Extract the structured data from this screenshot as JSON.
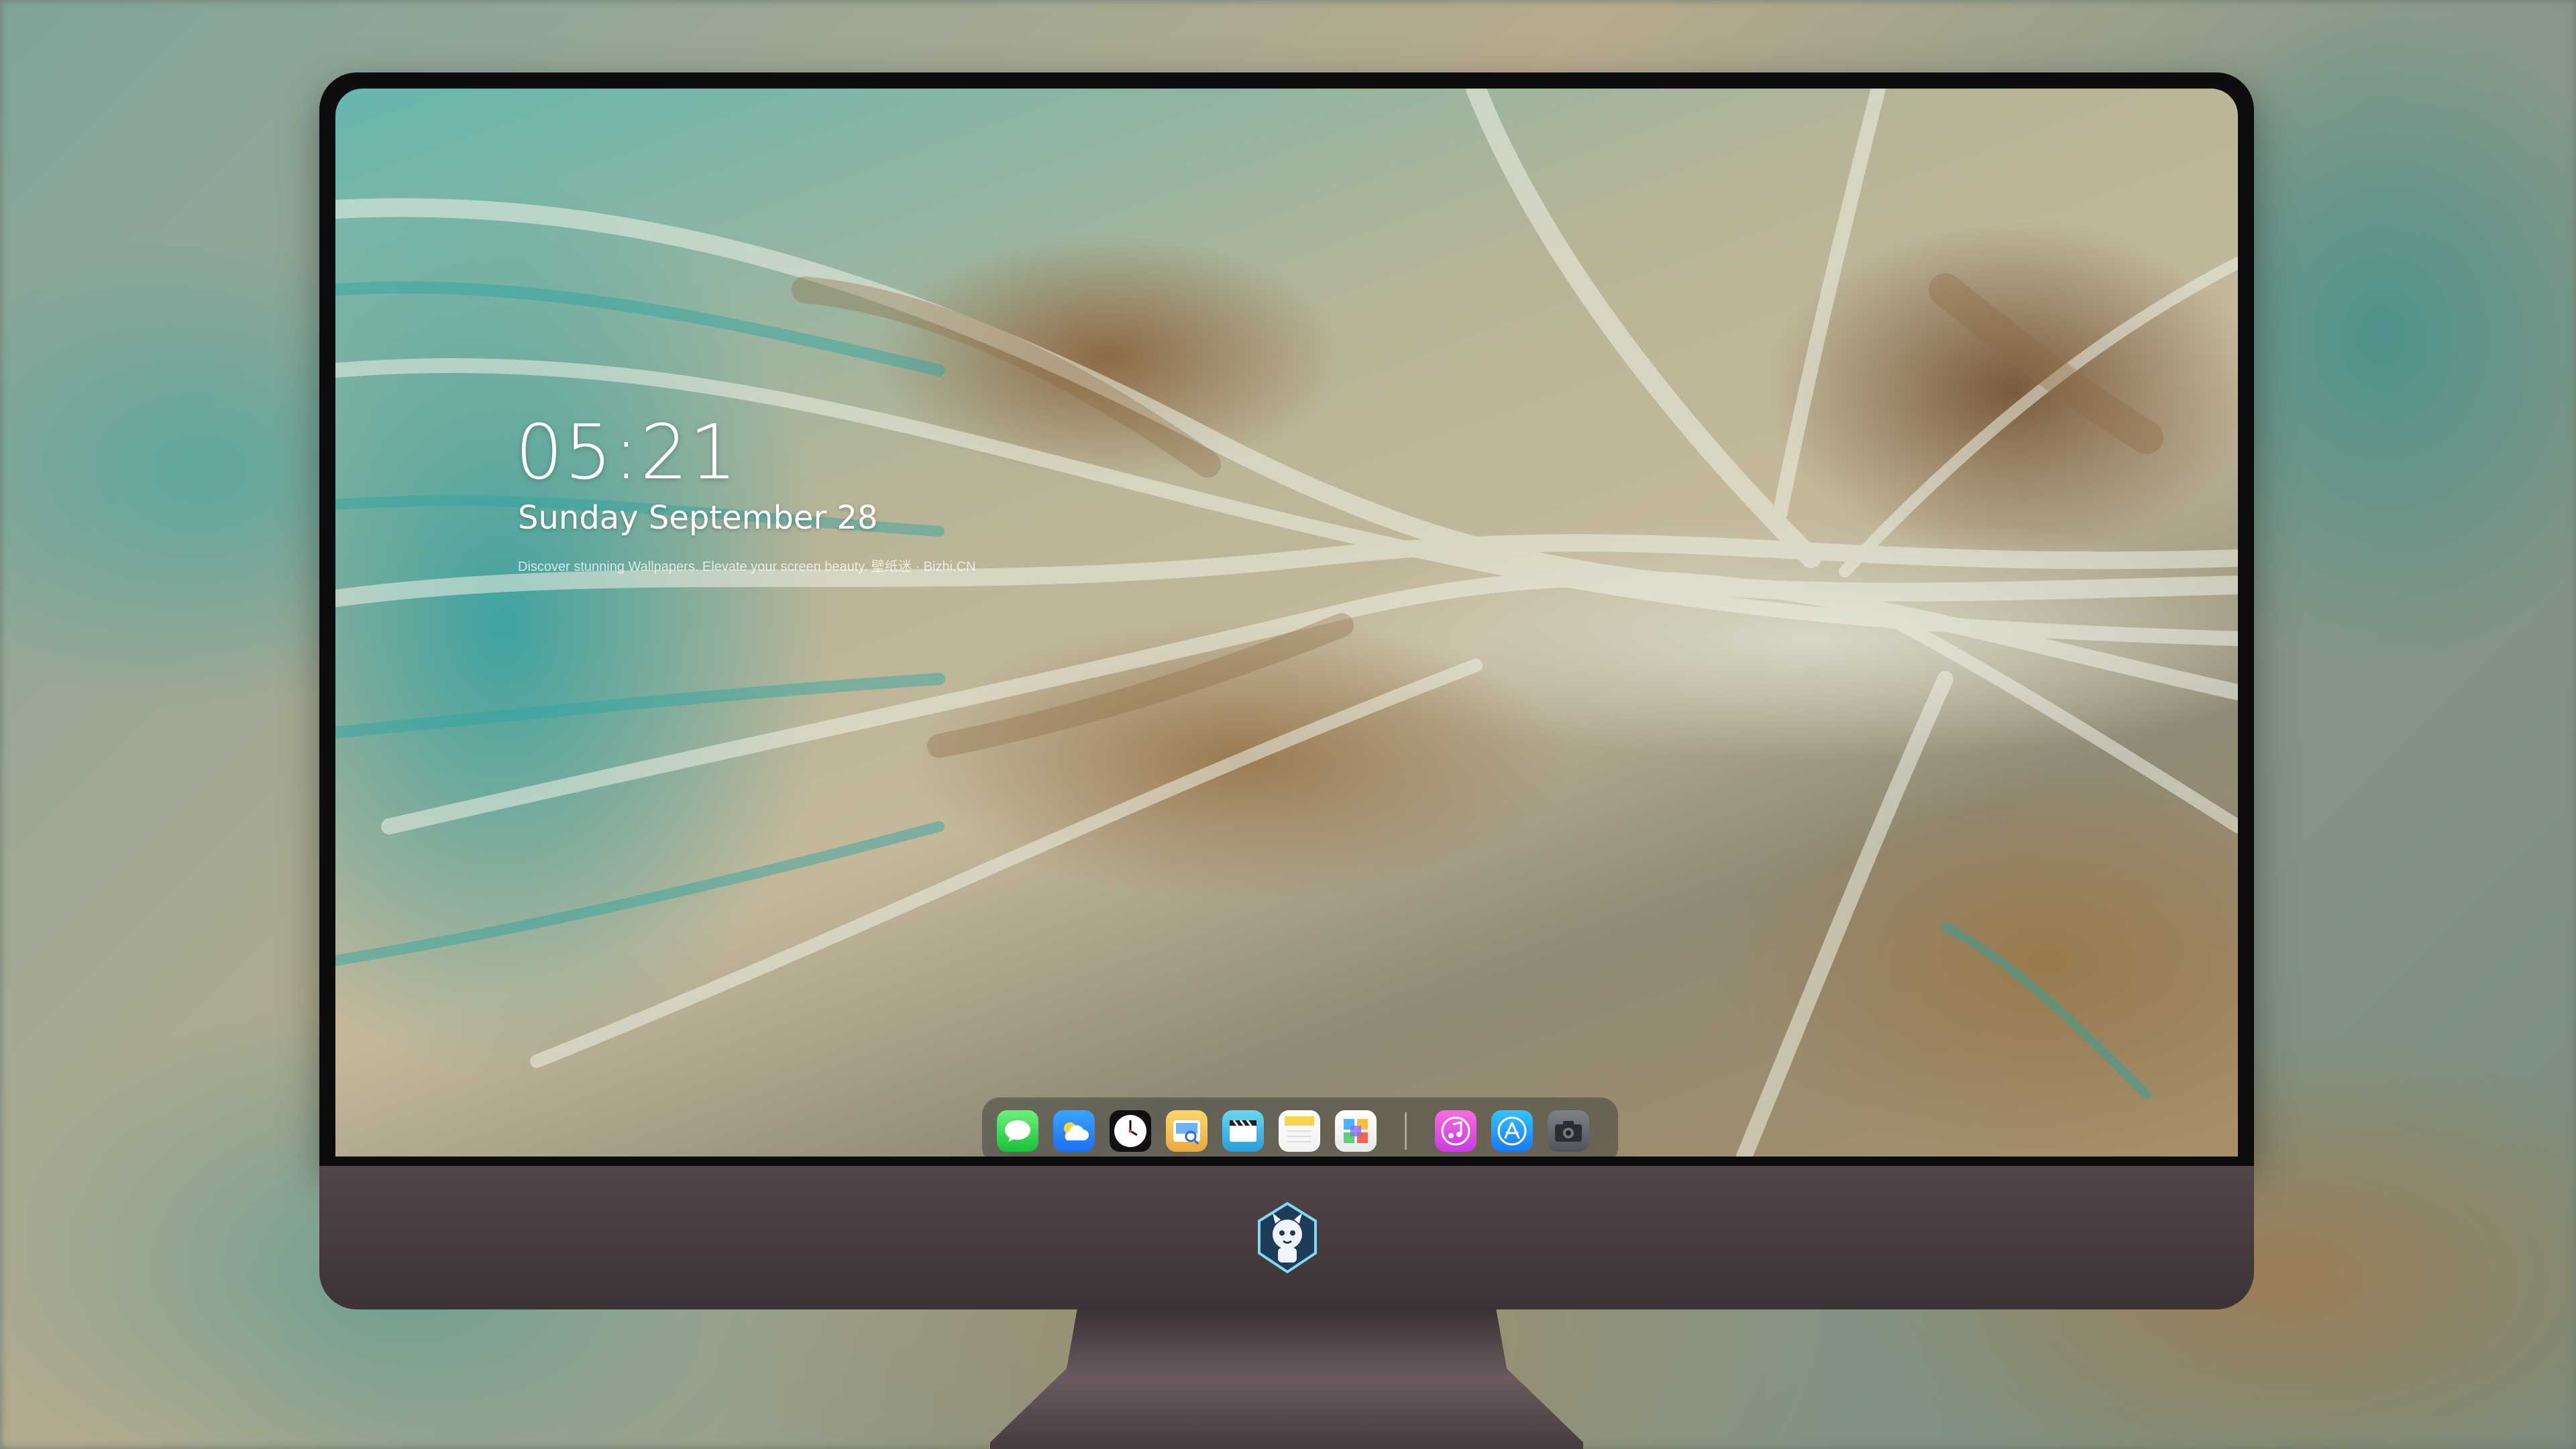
{
  "lockscreen": {
    "time": "05:21",
    "date": "Sunday September  28",
    "tagline": "Discover stunning Wallpapers. Elevate your screen beauty. 壁纸迷 · Bizhi.CN"
  },
  "dock": {
    "apps": [
      {
        "name": "Messages",
        "icon": "messages-icon",
        "color": "#2fd14a"
      },
      {
        "name": "Weather",
        "icon": "weather-icon",
        "color": "#2b8cf7"
      },
      {
        "name": "Clock",
        "icon": "clock-icon",
        "color": "#111111"
      },
      {
        "name": "Preview",
        "icon": "preview-icon",
        "color": "#f0c253"
      },
      {
        "name": "Video",
        "icon": "video-icon",
        "color": "#3fb7e6"
      },
      {
        "name": "Notes",
        "icon": "notes-icon",
        "color": "#f7d54a"
      },
      {
        "name": "Photos",
        "icon": "photos-icon",
        "color": "#ffffff"
      },
      {
        "name": "Music",
        "icon": "music-icon",
        "color": "#e556e2"
      },
      {
        "name": "App Store",
        "icon": "app-store-icon",
        "color": "#1f92f5"
      },
      {
        "name": "Camera",
        "icon": "camera-icon",
        "color": "#666b70"
      }
    ]
  },
  "monitor": {
    "logo": "mascot-logo-icon"
  }
}
